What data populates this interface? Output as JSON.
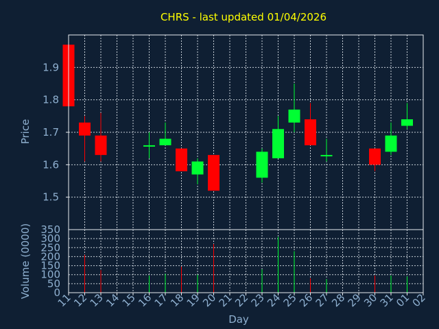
{
  "title": "CHRS - last updated 01/04/2026",
  "colors": {
    "background": "#0f1f33",
    "title": "#ffff00",
    "axis_text": "#8fb0d0",
    "frame": "#e8ecf0",
    "grid": "#c8d0d8",
    "up": "#00ff33",
    "down": "#ff0000"
  },
  "chart_data": [
    {
      "type": "candlestick",
      "ylabel": "Price",
      "ylim": [
        1.4,
        2.0
      ],
      "yticks": [
        1.5,
        1.6,
        1.7,
        1.8,
        1.9
      ],
      "grid": true,
      "candles": [
        {
          "x": "11",
          "open": 1.97,
          "close": 1.78,
          "high": 1.97,
          "low": 1.78
        },
        {
          "x": "12",
          "open": 1.73,
          "close": 1.69,
          "high": 1.75,
          "low": 1.61
        },
        {
          "x": "13",
          "open": 1.69,
          "close": 1.63,
          "high": 1.76,
          "low": 1.61
        },
        {
          "x": "16",
          "open": 1.66,
          "close": 1.66,
          "high": 1.7,
          "low": 1.62
        },
        {
          "x": "17",
          "open": 1.66,
          "close": 1.68,
          "high": 1.73,
          "low": 1.66
        },
        {
          "x": "18",
          "open": 1.65,
          "close": 1.58,
          "high": 1.65,
          "low": 1.58
        },
        {
          "x": "19",
          "open": 1.57,
          "close": 1.61,
          "high": 1.62,
          "low": 1.54
        },
        {
          "x": "20",
          "open": 1.63,
          "close": 1.52,
          "high": 1.63,
          "low": 1.52
        },
        {
          "x": "23",
          "open": 1.56,
          "close": 1.64,
          "high": 1.65,
          "low": 1.545
        },
        {
          "x": "24",
          "open": 1.62,
          "close": 1.71,
          "high": 1.75,
          "low": 1.62
        },
        {
          "x": "25",
          "open": 1.73,
          "close": 1.77,
          "high": 1.85,
          "low": 1.7
        },
        {
          "x": "26",
          "open": 1.74,
          "close": 1.66,
          "high": 1.79,
          "low": 1.66
        },
        {
          "x": "27",
          "open": 1.63,
          "close": 1.63,
          "high": 1.68,
          "low": 1.61
        },
        {
          "x": "30",
          "open": 1.65,
          "close": 1.6,
          "high": 1.65,
          "low": 1.58
        },
        {
          "x": "31",
          "open": 1.64,
          "close": 1.69,
          "high": 1.73,
          "low": 1.63
        },
        {
          "x": "01",
          "open": 1.72,
          "close": 1.74,
          "high": 1.79,
          "low": 1.71
        }
      ]
    },
    {
      "type": "bar",
      "xlabel": "Day",
      "ylabel": "Volume (0000)",
      "ylim": [
        0,
        350
      ],
      "yticks": [
        0,
        50,
        100,
        150,
        200,
        250,
        300,
        350
      ],
      "categories": [
        "11",
        "12",
        "13",
        "14",
        "15",
        "16",
        "17",
        "18",
        "19",
        "20",
        "21",
        "22",
        "23",
        "24",
        "25",
        "26",
        "27",
        "28",
        "29",
        "30",
        "31",
        "01",
        "02"
      ],
      "bars": [
        {
          "x": "12",
          "value": 210,
          "direction": "down"
        },
        {
          "x": "13",
          "value": 125,
          "direction": "down"
        },
        {
          "x": "16",
          "value": 95,
          "direction": "up"
        },
        {
          "x": "17",
          "value": 105,
          "direction": "up"
        },
        {
          "x": "18",
          "value": 145,
          "direction": "down"
        },
        {
          "x": "19",
          "value": 100,
          "direction": "up"
        },
        {
          "x": "20",
          "value": 270,
          "direction": "down"
        },
        {
          "x": "23",
          "value": 130,
          "direction": "up"
        },
        {
          "x": "24",
          "value": 310,
          "direction": "up"
        },
        {
          "x": "25",
          "value": 230,
          "direction": "up"
        },
        {
          "x": "26",
          "value": 80,
          "direction": "down"
        },
        {
          "x": "27",
          "value": 75,
          "direction": "up"
        },
        {
          "x": "30",
          "value": 95,
          "direction": "down"
        },
        {
          "x": "31",
          "value": 95,
          "direction": "up"
        },
        {
          "x": "01",
          "value": 90,
          "direction": "up"
        }
      ]
    }
  ]
}
